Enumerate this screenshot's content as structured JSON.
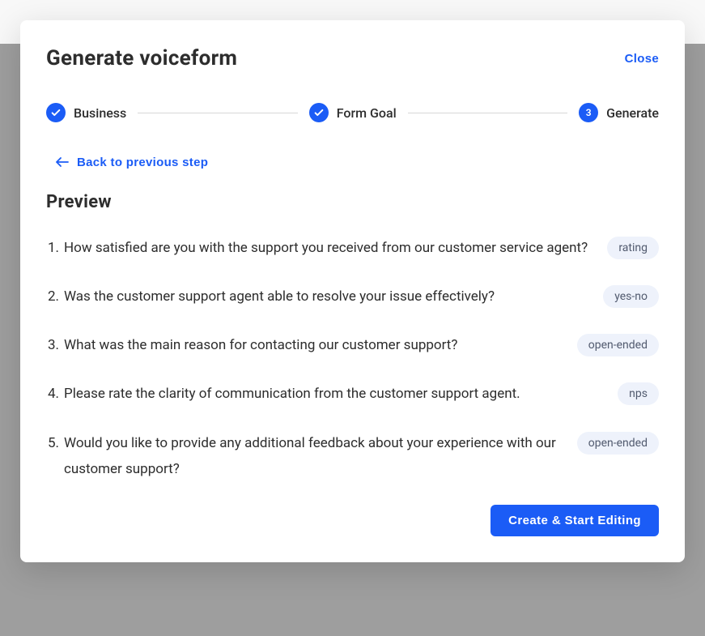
{
  "modal": {
    "title": "Generate voiceform",
    "close_label": "Close"
  },
  "stepper": {
    "steps": [
      {
        "label": "Business",
        "state": "complete"
      },
      {
        "label": "Form Goal",
        "state": "complete"
      },
      {
        "label": "Generate",
        "state": "active",
        "number": "3"
      }
    ]
  },
  "back": {
    "label": "Back to previous step"
  },
  "preview": {
    "title": "Preview",
    "questions": [
      {
        "text": "How satisfied are you with the support you received from our customer service agent?",
        "tag": "rating"
      },
      {
        "text": "Was the customer support agent able to resolve your issue effectively?",
        "tag": "yes-no"
      },
      {
        "text": "What was the main reason for contacting our customer support?",
        "tag": "open-ended"
      },
      {
        "text": "Please rate the clarity of communication from the customer support agent.",
        "tag": "nps"
      },
      {
        "text": "Would you like to provide any additional feedback about your experience with our customer support?",
        "tag": "open-ended"
      }
    ]
  },
  "footer": {
    "cta_label": "Create & Start Editing"
  }
}
